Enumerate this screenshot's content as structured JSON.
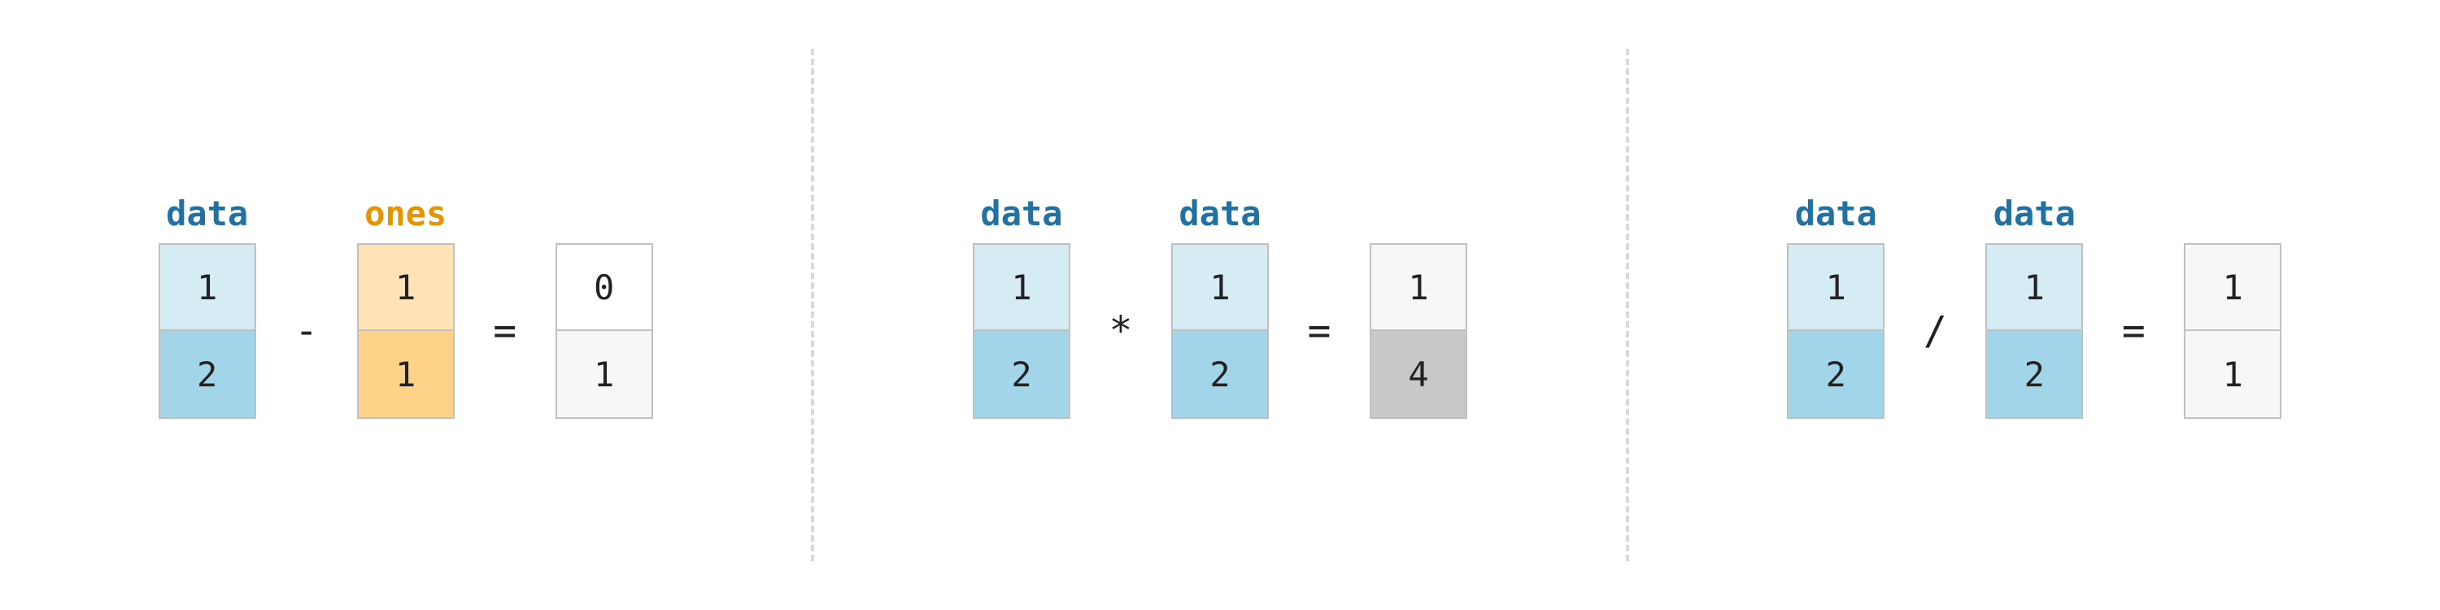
{
  "labels": {
    "data": "data",
    "ones": "ones",
    "blank": " "
  },
  "arrays": {
    "data": [
      "1",
      "2"
    ],
    "ones": [
      "1",
      "1"
    ],
    "sub": [
      "0",
      "1"
    ],
    "mul": [
      "1",
      "4"
    ],
    "div": [
      "1",
      "1"
    ]
  },
  "ops": {
    "minus": "-",
    "times": "*",
    "divide": "/",
    "equals": "="
  }
}
